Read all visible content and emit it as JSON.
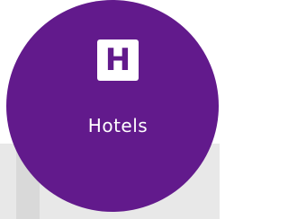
{
  "tile": {
    "icon": "hotel-icon",
    "icon_letter": "H",
    "label": "Hotels",
    "color": "#621a8c",
    "text_color": "#ffffff"
  }
}
